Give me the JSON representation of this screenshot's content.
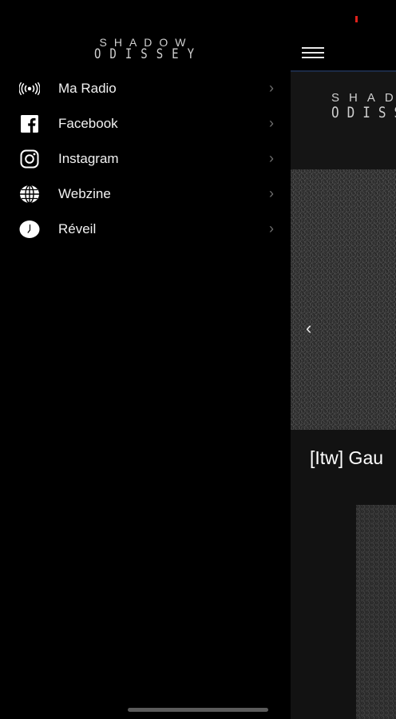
{
  "app": {
    "logo_line1": "SHADOW",
    "logo_line2": "ODISSEY",
    "hero_caption": "[Itw] Gau",
    "slider_prev_glyph": "‹"
  },
  "drawer": {
    "logo_line1": "SHADOW",
    "logo_line2": "ODISSEY",
    "items": [
      {
        "label": "Ma Radio",
        "icon": "radio-broadcast-icon"
      },
      {
        "label": "Facebook",
        "icon": "facebook-icon"
      },
      {
        "label": "Instagram",
        "icon": "instagram-icon"
      },
      {
        "label": "Webzine",
        "icon": "globe-icon"
      },
      {
        "label": "Réveil",
        "icon": "alarm-clock-icon"
      }
    ],
    "chevron_glyph": "›"
  },
  "colors": {
    "background": "#000000",
    "status_indicator": "#e0211b",
    "accent_line": "#1c2a45"
  }
}
